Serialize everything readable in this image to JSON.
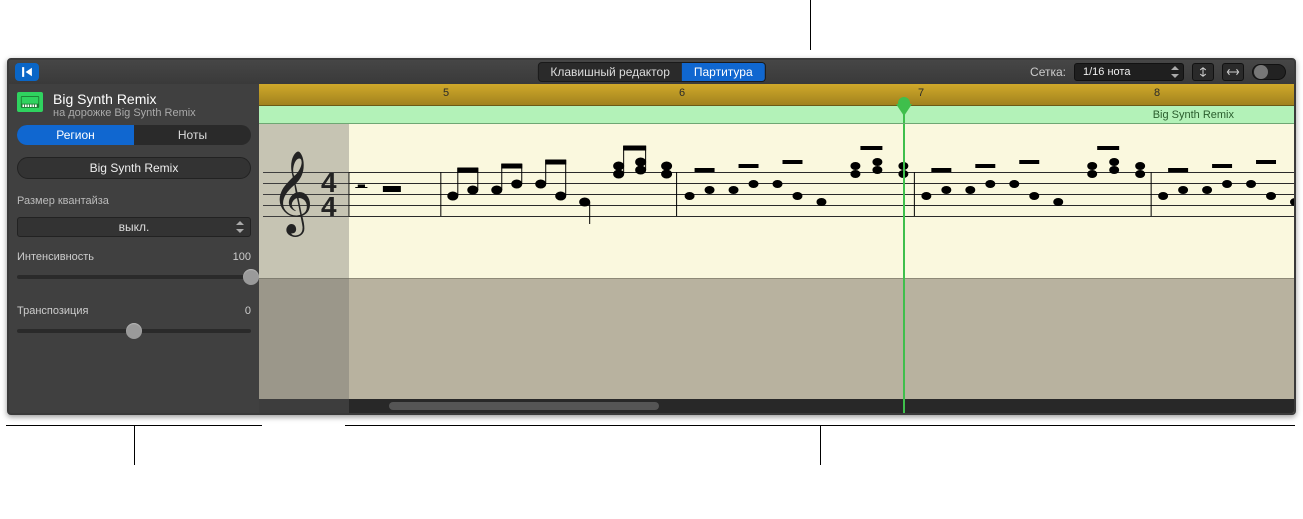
{
  "toolbar": {
    "view_tabs": {
      "keyboard": "Клавишный редактор",
      "score": "Партитура"
    },
    "grid_label": "Сетка:",
    "grid_value": "1/16 нота"
  },
  "inspector": {
    "title": "Big Synth Remix",
    "subtitle": "на дорожке Big Synth Remix",
    "tabs": {
      "region": "Регион",
      "notes": "Ноты"
    },
    "region_name": "Big Synth Remix",
    "quantize_label": "Размер квантайза",
    "quantize_value": "выкл.",
    "intensity_label": "Интенсивность",
    "intensity_value": "100",
    "transpose_label": "Транспозиция",
    "transpose_value": "0"
  },
  "score": {
    "ruler_ticks": [
      "5",
      "6",
      "7",
      "8"
    ],
    "region_name": "Big Synth Remix"
  }
}
